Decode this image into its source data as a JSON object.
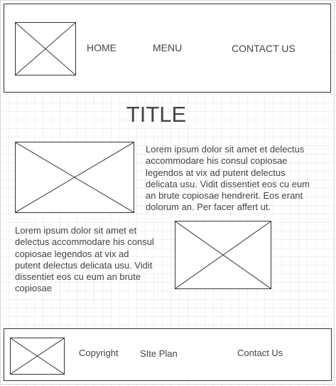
{
  "header": {
    "logo_icon": "image-placeholder-icon",
    "nav": [
      "HOME",
      "MENU",
      "CONTACT US"
    ]
  },
  "main": {
    "title": "TITLE",
    "block1": {
      "image_icon": "image-placeholder-icon",
      "text": "Lorem ipsum dolor sit amet et delectus accommodare his consul copiosae legendos at vix ad putent delectus delicata usu. Vidit dissentiet eos cu eum an brute copiosae hendrerit. Eos erant dolorum an. Per facer affert ut."
    },
    "block2": {
      "image_icon": "image-placeholder-icon",
      "text": "Lorem ipsum dolor sit amet et delectus accommodare his consul copiosae legendos at vix ad putent delectus delicata usu. Vidit dissentiet eos cu eum an brute copiosae"
    }
  },
  "footer": {
    "logo_icon": "image-placeholder-icon",
    "links": [
      "Copyright",
      "SIte Plan",
      "Contact Us"
    ]
  }
}
